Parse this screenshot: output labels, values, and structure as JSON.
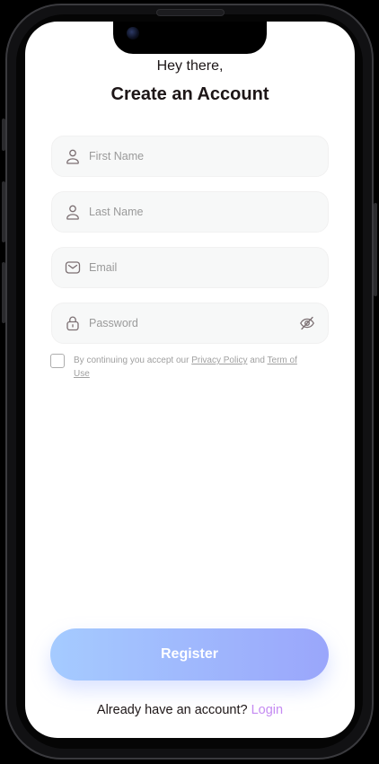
{
  "header": {
    "greeting": "Hey there,",
    "title": "Create an Account"
  },
  "form": {
    "first_name": {
      "placeholder": "First Name",
      "value": "",
      "icon": "user-icon"
    },
    "last_name": {
      "placeholder": "Last Name",
      "value": "",
      "icon": "user-icon"
    },
    "email": {
      "placeholder": "Email",
      "value": "",
      "icon": "mail-icon"
    },
    "password": {
      "placeholder": "Password",
      "value": "",
      "icon": "lock-icon",
      "toggle_icon": "eye-off-icon"
    }
  },
  "consent": {
    "prefix": "By continuing you accept our ",
    "privacy_policy": "Privacy Policy",
    "middle": " and ",
    "terms": "Term of Use",
    "checked": false
  },
  "actions": {
    "register_label": "Register"
  },
  "footer": {
    "prompt": "Already have an account? ",
    "login_label": "Login"
  },
  "colors": {
    "text_primary": "#1d1617",
    "placeholder": "#9a9a9a",
    "field_bg": "#f7f8f8",
    "gradient_start": "#a5cbff",
    "gradient_end": "#9aa6fb",
    "login_link": "#c58bf2"
  }
}
